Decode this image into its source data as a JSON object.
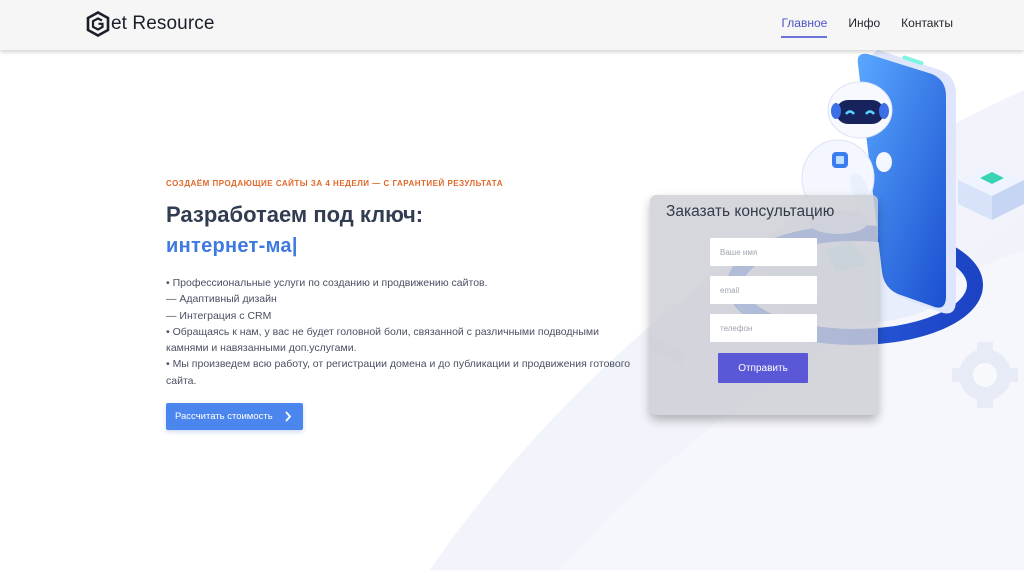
{
  "header": {
    "logo_text": "et Resource",
    "nav": [
      {
        "label": "Главное",
        "active": true
      },
      {
        "label": "Инфо",
        "active": false
      },
      {
        "label": "Контакты",
        "active": false
      }
    ]
  },
  "hero": {
    "eyebrow": "СОЗДАЁМ ПРОДАЮЩИЕ САЙТЫ ЗА 4 НЕДЕЛИ — С ГАРАНТИЕЙ РЕЗУЛЬТАТА",
    "title": "Разработаем под ключ:",
    "typed": "интернет-ма|",
    "features": [
      "• Профессиональные услуги по созданию и продвижению сайтов.",
      "— Адаптивный дизайн",
      "— Интеграция с CRM",
      "• Обращаясь к нам, у вас не будет головной боли, связанной с различными подводными камнями и навязанными доп.услугами.",
      "• Мы произведем всю работу, от регистрации домена и до публикации и продвижения готового сайта."
    ],
    "cta_label": "Рассчитать стоимость"
  },
  "form": {
    "title": "Заказать консультацию",
    "name_placeholder": "Ваше имя",
    "email_placeholder": "email",
    "phone_placeholder": "телефон",
    "submit_label": "Отправить"
  },
  "colors": {
    "accent": "#4b86ef",
    "nav_active": "#4a52c8",
    "eyebrow": "#e0692b",
    "submit": "#5b58d8"
  }
}
